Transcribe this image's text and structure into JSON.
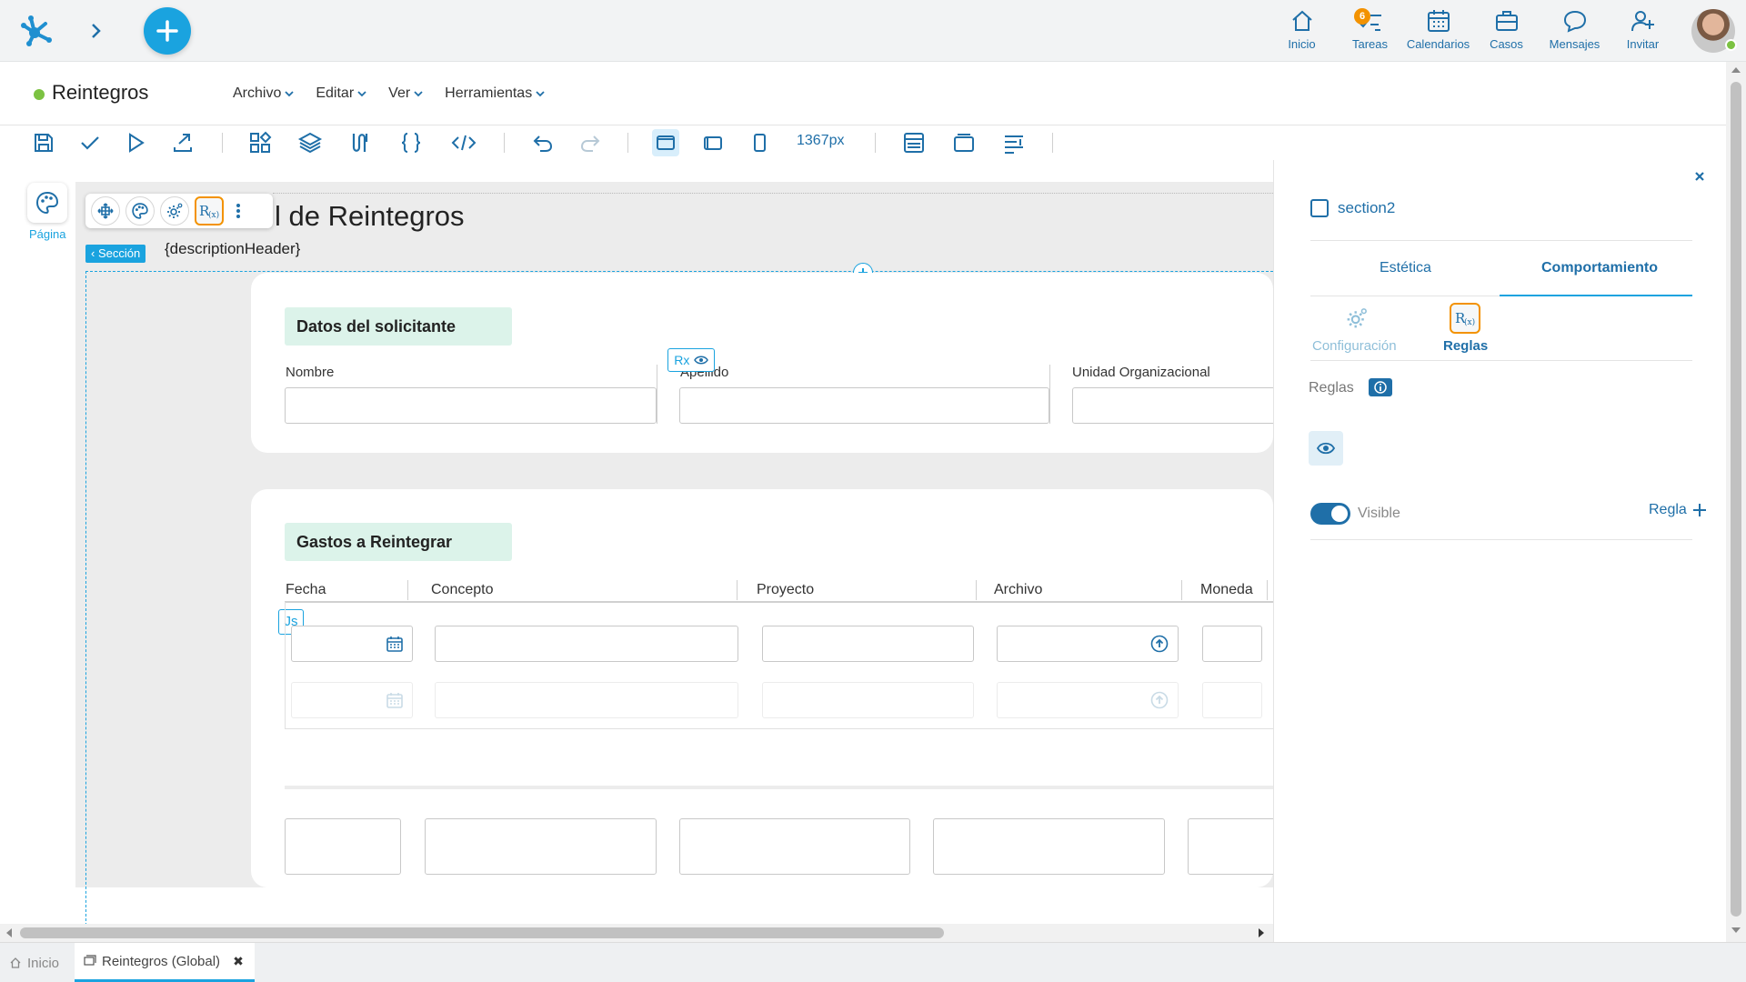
{
  "topbar": {
    "nav": [
      {
        "label": "Inicio",
        "icon": "home-icon"
      },
      {
        "label": "Tareas",
        "icon": "tasks-icon",
        "badge": "6"
      },
      {
        "label": "Calendarios",
        "icon": "calendar-icon"
      },
      {
        "label": "Casos",
        "icon": "briefcase-icon"
      },
      {
        "label": "Mensajes",
        "icon": "message-icon"
      },
      {
        "label": "Invitar",
        "icon": "invite-user-icon"
      }
    ]
  },
  "titlebar": {
    "title": "Reintegros",
    "menu": [
      "Archivo",
      "Editar",
      "Ver",
      "Herramientas"
    ]
  },
  "toolbar": {
    "width_value": "1367px"
  },
  "canvas": {
    "pagina_label": "Página",
    "seccion_tag": "Sección",
    "heading": "l de Reintegros",
    "description": "{descriptionHeader}",
    "rx_chip": "Rx",
    "js_chip": "Js",
    "card1": {
      "title": "Datos del solicitante",
      "fields": [
        "Nombre",
        "Apellido",
        "Unidad Organizacional"
      ]
    },
    "card2": {
      "title": "Gastos a Reintegrar",
      "columns": [
        "Fecha",
        "Concepto",
        "Proyecto",
        "Archivo",
        "Moneda"
      ]
    }
  },
  "panel": {
    "element_name": "section2",
    "tabs": [
      "Estética",
      "Comportamiento"
    ],
    "subtabs": [
      "Configuración",
      "Reglas"
    ],
    "reglas_label": "Reglas",
    "visible_label": "Visible",
    "add_rule_label": "Regla"
  },
  "bottom_tabs": [
    {
      "label": "Inicio"
    },
    {
      "label": "Reintegros (Global)"
    }
  ],
  "colors": {
    "accent": "#1aa3df",
    "primary": "#1f6fa8",
    "highlight": "#f39200",
    "status_green": "#7cc242",
    "section_title_bg": "#dcf3ea"
  }
}
